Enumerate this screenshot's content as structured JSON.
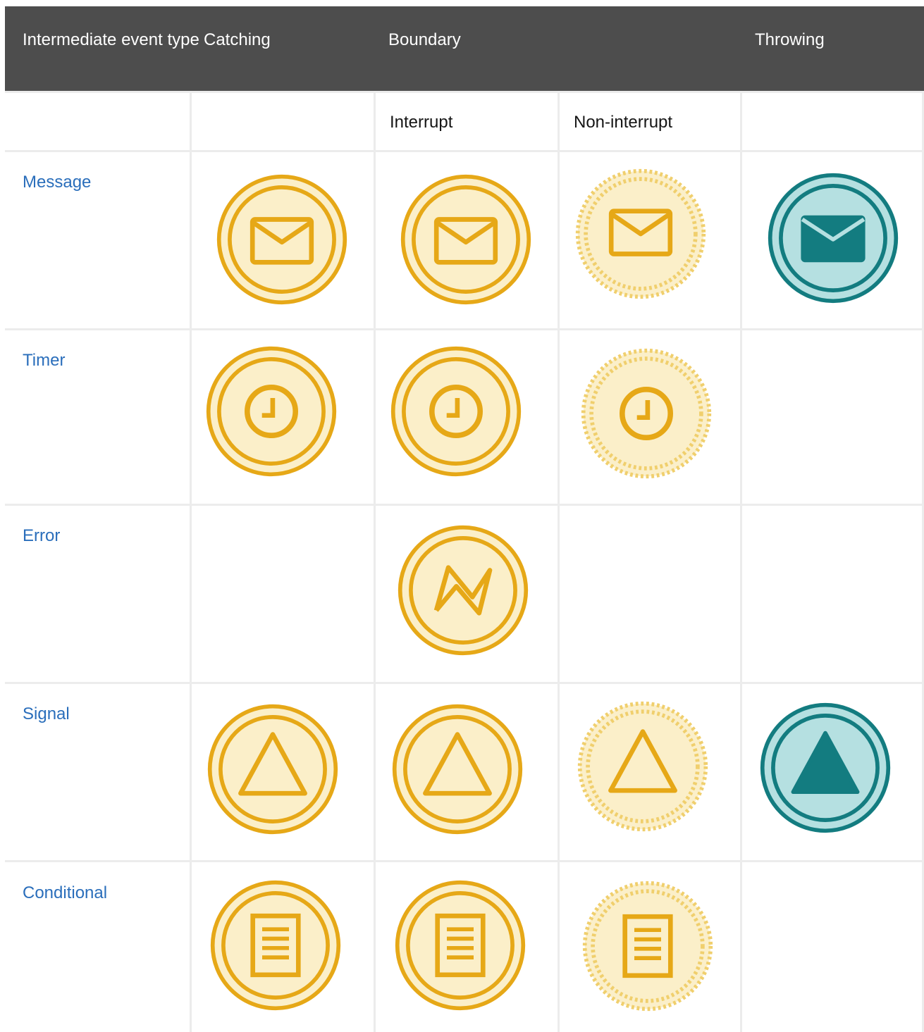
{
  "table": {
    "header": {
      "event_type": "Intermediate event type",
      "catching": "Catching",
      "boundary": "Boundary",
      "throwing": "Throwing"
    },
    "subheader": {
      "interrupt": "Interrupt",
      "non_interrupt": "Non-interrupt"
    },
    "rows": [
      {
        "label": "Message",
        "catching": "message-icon",
        "interrupt": "message-icon",
        "non_interrupt": "message-icon",
        "throwing": "message-icon"
      },
      {
        "label": "Timer",
        "catching": "timer-icon",
        "interrupt": "timer-icon",
        "non_interrupt": "timer-icon",
        "throwing": ""
      },
      {
        "label": "Error",
        "catching": "",
        "interrupt": "error-icon",
        "non_interrupt": "",
        "throwing": ""
      },
      {
        "label": "Signal",
        "catching": "signal-icon",
        "interrupt": "signal-icon",
        "non_interrupt": "signal-icon",
        "throwing": "signal-icon"
      },
      {
        "label": "Conditional",
        "catching": "conditional-icon",
        "interrupt": "conditional-icon",
        "non_interrupt": "conditional-icon",
        "throwing": ""
      }
    ]
  },
  "colors": {
    "header_bg": "#4d4d4d",
    "catching_stroke": "#e6a817",
    "catching_fill": "#fbefc9",
    "throwing_stroke": "#137c80",
    "throwing_fill": "#b5e0e1",
    "link": "#2a6ebb"
  }
}
